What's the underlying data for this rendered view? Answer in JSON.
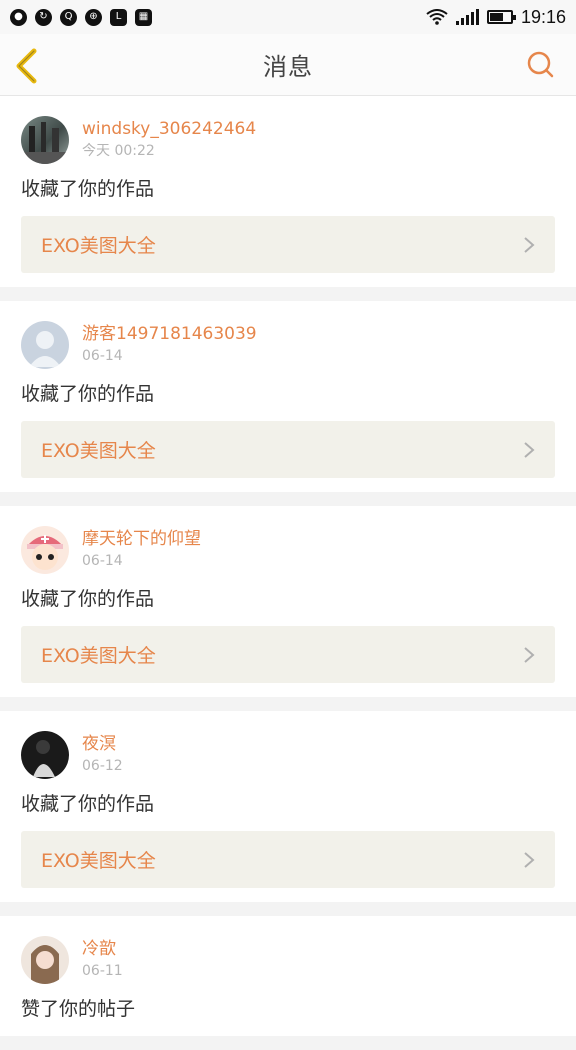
{
  "status_bar": {
    "time": "19:16",
    "left_icons": [
      "message-icon",
      "sync-icon",
      "qq-icon",
      "globe-icon",
      "app-icon",
      "grid-icon"
    ],
    "right_icons": [
      "wifi-icon",
      "signal-icon",
      "battery-icon"
    ]
  },
  "header": {
    "title": "消息",
    "back_icon": "chevron-left-icon",
    "search_icon": "search-icon",
    "accent_color": "#e6864b",
    "back_color": "#e8b90f"
  },
  "messages": [
    {
      "username": "windsky_306242464",
      "time": "今天 00:22",
      "action": "收藏了你的作品",
      "work": "EXO美图大全",
      "avatar": "photo"
    },
    {
      "username": "游客1497181463039",
      "time": "06-14",
      "action": "收藏了你的作品",
      "work": "EXO美图大全",
      "avatar": "default"
    },
    {
      "username": "摩天轮下的仰望",
      "time": "06-14",
      "action": "收藏了你的作品",
      "work": "EXO美图大全",
      "avatar": "cartoon"
    },
    {
      "username": "夜溟",
      "time": "06-12",
      "action": "收藏了你的作品",
      "work": "EXO美图大全",
      "avatar": "dark"
    },
    {
      "username": "冷歆",
      "time": "06-11",
      "action": "赞了你的帖子",
      "work": "",
      "avatar": "girl"
    }
  ]
}
